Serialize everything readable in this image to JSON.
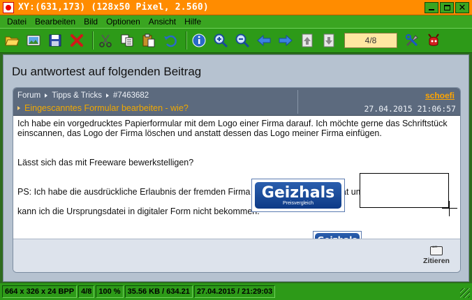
{
  "window": {
    "title": "XY:(631,173) (128x50 Pixel, 2.560)"
  },
  "menu": [
    "Datei",
    "Bearbeiten",
    "Bild",
    "Optionen",
    "Ansicht",
    "Hilfe"
  ],
  "toolbar": {
    "icons": [
      "open-folder-icon",
      "slideshow-icon",
      "save-icon",
      "delete-icon",
      "cut-icon",
      "copy-icon",
      "paste-icon",
      "undo-icon",
      "info-icon",
      "zoom-in-icon",
      "zoom-out-icon",
      "previous-icon",
      "next-icon",
      "first-page-icon",
      "last-page-icon",
      "settings-icon",
      "close-app-icon"
    ],
    "page_counter": "4/8"
  },
  "content": {
    "heading": "Du antwortest auf folgenden Beitrag"
  },
  "post": {
    "breadcrumb": [
      "Forum",
      "Tipps & Tricks",
      "#7463682"
    ],
    "thread_title": "Eingescanntes Formular bearbeiten - wie?",
    "author": "schoefi",
    "date": "27.04.2015 21:06:57",
    "body": {
      "p1": "Ich habe ein vorgedrucktes Papierformular mit dem Logo einer Firma darauf. Ich möchte gerne das Schriftstück einscannen, das Logo der Firma löschen und anstatt dessen das Logo meiner Firma einfügen.",
      "p2": "Lässt sich das mit Freeware bewerkstelligen?",
      "p3": "PS: Ich habe die ausdrückliche Erlaubnis der fremden Firma mein Vorhaben in die Tat umzusetzen, leider",
      "p4": "kann ich die Ursprungsdatei  in digitaler Form nicht bekommen."
    },
    "logo": {
      "word": "Geizhals",
      "sub": "Preisvergleich"
    },
    "quote_label": "Zitieren"
  },
  "status": {
    "dimensions": "664 x 326 x 24 BPP",
    "index": "4/8",
    "zoom": "100 %",
    "size": "35.56 KB / 634.21",
    "datetime": "27.04.2015 / 21:29:03"
  }
}
